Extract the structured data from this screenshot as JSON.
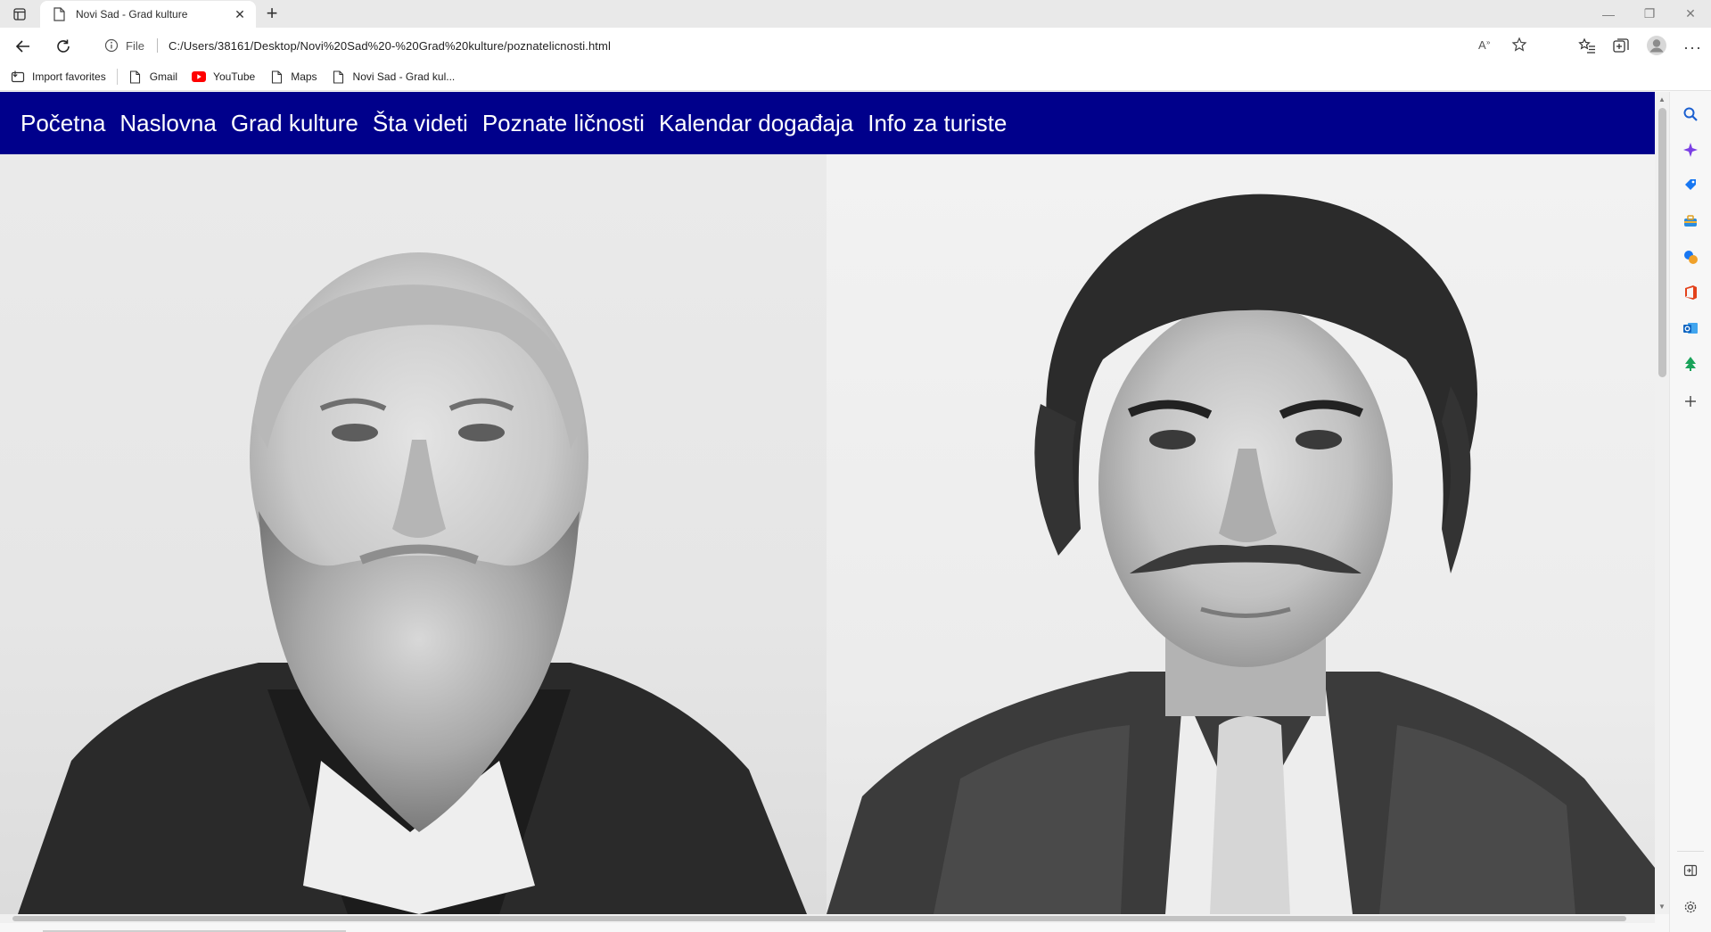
{
  "browser": {
    "tab_title": "Novi Sad - Grad kulture",
    "address_scheme": "File",
    "address_url": "C:/Users/38161/Desktop/Novi%20Sad%20-%20Grad%20kulture/poznatelicnosti.html",
    "bookmarks": [
      {
        "label": "Import favorites",
        "icon": "import-icon"
      },
      {
        "label": "Gmail",
        "icon": "page-icon"
      },
      {
        "label": "YouTube",
        "icon": "youtube-icon"
      },
      {
        "label": "Maps",
        "icon": "page-icon"
      },
      {
        "label": "Novi Sad - Grad kul...",
        "icon": "page-icon"
      }
    ]
  },
  "site": {
    "nav": [
      "Početna",
      "Naslovna",
      "Grad kulture",
      "Šta videti",
      "Poznate ličnosti",
      "Kalendar događaja",
      "Info za turiste"
    ],
    "nav_color": "#00008b"
  },
  "photos": [
    {
      "name": "portrait-bearded-man",
      "icon": "photo"
    },
    {
      "name": "portrait-mustached-man",
      "icon": "photo"
    }
  ]
}
